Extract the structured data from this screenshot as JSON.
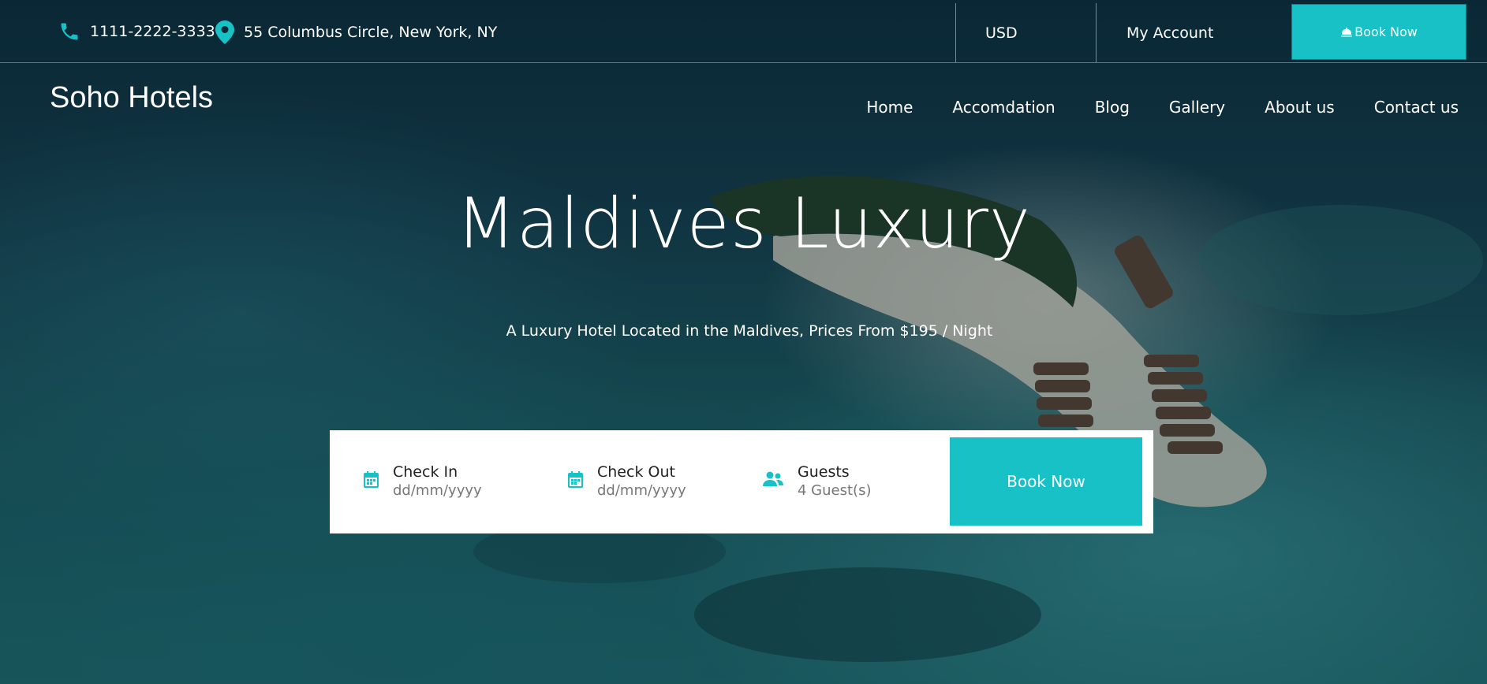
{
  "topbar": {
    "phone": "1111-2222-3333",
    "address": "55 Columbus Circle, New York, NY",
    "currency": "USD",
    "account": "My Account",
    "book_now": "Book Now"
  },
  "brand": "Soho Hotels",
  "nav": {
    "items": [
      "Home",
      "Accomdation",
      "Blog",
      "Gallery",
      "About us",
      "Contact us"
    ]
  },
  "hero": {
    "title": "Maldives Luxury",
    "subtitle": "A Luxury Hotel Located in the Maldives, Prices From $195 / Night"
  },
  "booking": {
    "checkin_label": "Check In",
    "checkin_placeholder": "dd/mm/yyyy",
    "checkout_label": "Check Out",
    "checkout_placeholder": "dd/mm/yyyy",
    "guests_label": "Guests",
    "guests_value": "4 Guest(s)",
    "submit": "Book Now"
  },
  "colors": {
    "accent": "#17c1c5",
    "ocean_dark": "#0d2f3f",
    "ocean_light": "#1f6e72"
  },
  "icons": [
    "phone-icon",
    "map-pin-icon",
    "bell-icon",
    "calendar-icon",
    "users-icon"
  ]
}
